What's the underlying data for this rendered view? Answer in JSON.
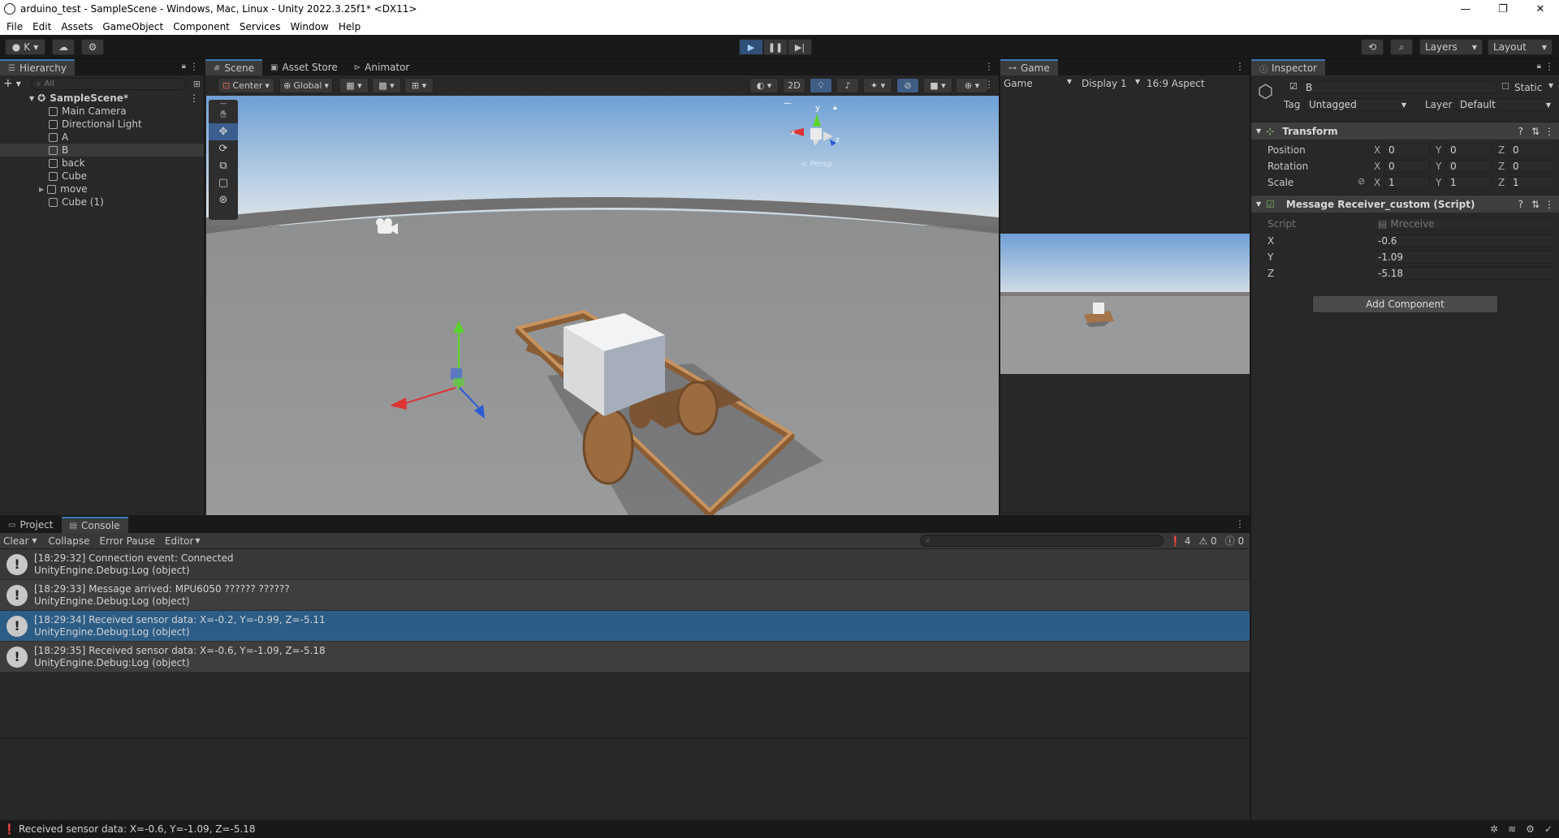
{
  "window": {
    "title": "arduino_test - SampleScene - Windows, Mac, Linux - Unity 2022.3.25f1* <DX11>",
    "minimize": "—",
    "maximize": "❐",
    "close": "✕"
  },
  "menu": [
    "File",
    "Edit",
    "Assets",
    "GameObject",
    "Component",
    "Services",
    "Window",
    "Help"
  ],
  "toolbar": {
    "account": "K",
    "layers": "Layers",
    "layout": "Layout"
  },
  "hierarchy": {
    "tab": "Hierarchy",
    "search_placeholder": "All",
    "scene": "SampleScene*",
    "items": [
      "Main Camera",
      "Directional Light",
      "A",
      "B",
      "back",
      "Cube",
      "move",
      "Cube (1)"
    ]
  },
  "scene": {
    "tabs": [
      "Scene",
      "Asset Store",
      "Animator"
    ],
    "pivot": "Center",
    "space": "Global",
    "mode_2d": "2D",
    "gizmo_label": "< Persp"
  },
  "game": {
    "tab": "Game",
    "mode": "Game",
    "display": "Display 1",
    "aspect": "16:9 Aspect"
  },
  "inspector": {
    "tab": "Inspector",
    "object_name": "B",
    "static_label": "Static",
    "tag_label": "Tag",
    "tag_value": "Untagged",
    "layer_label": "Layer",
    "layer_value": "Default",
    "transform": {
      "header": "Transform",
      "position_label": "Position",
      "position": [
        "0",
        "0",
        "0"
      ],
      "rotation_label": "Rotation",
      "rotation": [
        "0",
        "0",
        "0"
      ],
      "scale_label": "Scale",
      "scale": [
        "1",
        "1",
        "1"
      ]
    },
    "script_component": {
      "header": "Message Receiver_custom (Script)",
      "script_label": "Script",
      "script_value": "Mreceive",
      "x_label": "X",
      "x_value": "-0.6",
      "y_label": "Y",
      "y_value": "-1.09",
      "z_label": "Z",
      "z_value": "-5.18"
    },
    "add_component": "Add Component"
  },
  "console": {
    "tabs": [
      "Project",
      "Console"
    ],
    "clear": "Clear",
    "collapse": "Collapse",
    "error_pause": "Error Pause",
    "editor": "Editor",
    "counts": {
      "log": "4",
      "warn": "0",
      "error": "0"
    },
    "entries": [
      {
        "line1": "[18:29:32] Connection event: Connected",
        "line2": "UnityEngine.Debug:Log (object)"
      },
      {
        "line1": "[18:29:33] Message arrived: MPU6050 ?????? ??????",
        "line2": "UnityEngine.Debug:Log (object)"
      },
      {
        "line1": "[18:29:34] Received sensor data: X=-0.2, Y=-0.99, Z=-5.11",
        "line2": "UnityEngine.Debug:Log (object)"
      },
      {
        "line1": "[18:29:35] Received sensor data: X=-0.6, Y=-1.09, Z=-5.18",
        "line2": "UnityEngine.Debug:Log (object)"
      }
    ]
  },
  "status": "Received sensor data: X=-0.6, Y=-1.09, Z=-5.18"
}
